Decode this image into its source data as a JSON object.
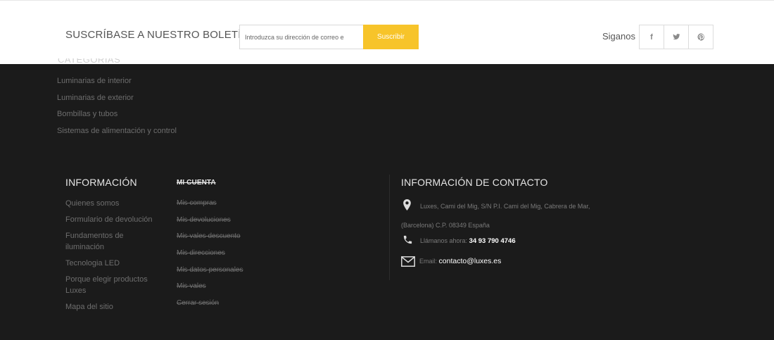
{
  "newsletter": {
    "title": "SUSCRÍBASE A NUESTRO BOLETÍN",
    "placeholder": "Introduzca su dirección de correo e",
    "button": "Suscribir",
    "follow_label": "Siganos",
    "accent_color": "#f7c42a"
  },
  "social": [
    {
      "icon": "facebook-icon",
      "glyph": "f"
    },
    {
      "icon": "twitter-icon",
      "glyph": "twitter"
    },
    {
      "icon": "pinterest-icon",
      "glyph": "pinterest"
    }
  ],
  "categories": {
    "items": [
      "Luminarias de interior",
      "Luminarias de exterior",
      "Bombillas y tubos",
      "Sistemas de alimentación y control"
    ]
  },
  "information": {
    "title": "INFORMACIÓN",
    "items": [
      "Quienes somos",
      "Formulario de devolución",
      "Fundamentos de iluminación",
      "Tecnologia LED",
      "Porque elegir productos Luxes",
      "Mapa del sitio"
    ]
  },
  "account": {
    "title": "MI CUENTA",
    "items": [
      "Mis compras",
      "Mis devoluciones",
      "Mis vales descuento",
      "Mis direcciones",
      "Mis datos personales",
      "Mis vales",
      "Cerrar sesión"
    ]
  },
  "contact": {
    "title": "INFORMACIÓN DE CONTACTO",
    "address": "Luxes, Cami del Mig, S/N P.I. Cami del Mig, Cabrera de Mar, (Barcelona) C.P. 08349 España",
    "phone_label": "Llámanos ahora:",
    "phone": "34 93 790 4746",
    "email_label": "Email:",
    "email": "contacto@luxes.es"
  }
}
